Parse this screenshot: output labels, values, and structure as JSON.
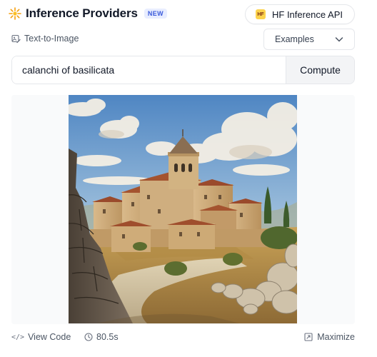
{
  "header": {
    "title": "Inference Providers",
    "badge": "NEW",
    "provider": {
      "logo_text": "HF",
      "label": "HF Inference API"
    }
  },
  "task": {
    "icon": "image-edit-icon",
    "label": "Text-to-Image"
  },
  "examples": {
    "label": "Examples",
    "icon": "chevron-down-icon"
  },
  "prompt": {
    "value": "calanchi of basilicata",
    "submit_label": "Compute"
  },
  "footer": {
    "view_code_label": "View Code",
    "timing": "80.5s",
    "maximize_label": "Maximize"
  },
  "colors": {
    "badge_text": "#3b5bdb",
    "badge_bg": "#e8edff",
    "hf_yellow": "#fcd34d",
    "border": "#e5e7eb"
  }
}
